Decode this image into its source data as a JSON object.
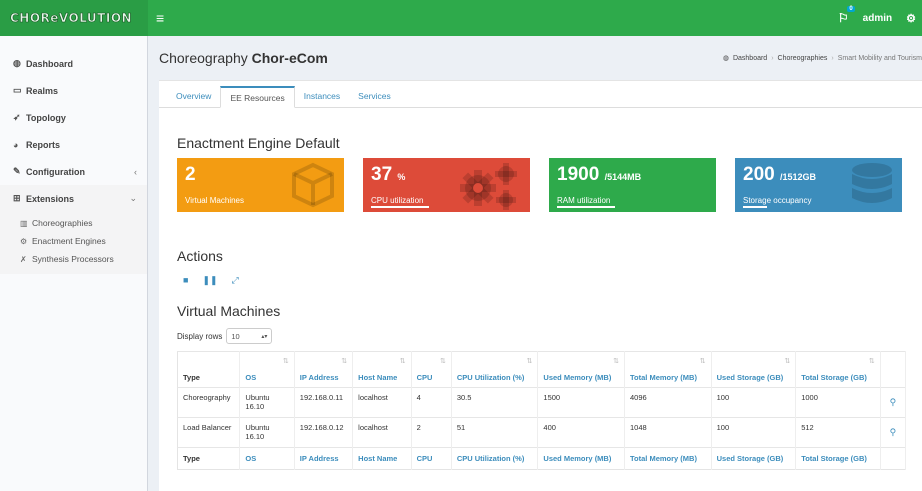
{
  "app": {
    "logo_text": "CHOReVOLUTION",
    "user": "admin",
    "notification_count": "0"
  },
  "sidebar": {
    "items": [
      {
        "label": "Dashboard",
        "icon": "dashboard-icon"
      },
      {
        "label": "Realms",
        "icon": "folder-icon"
      },
      {
        "label": "Topology",
        "icon": "rocket-icon"
      },
      {
        "label": "Reports",
        "icon": "pie-chart-icon"
      },
      {
        "label": "Configuration",
        "icon": "edit-icon"
      },
      {
        "label": "Extensions",
        "icon": "sitemap-icon"
      }
    ],
    "subitems": [
      {
        "label": "Choreographies",
        "icon": "bar-chart-icon"
      },
      {
        "label": "Enactment Engines",
        "icon": "gears-icon"
      },
      {
        "label": "Synthesis Processors",
        "icon": "wrench-icon"
      }
    ]
  },
  "header": {
    "title_prefix": "Choreography",
    "title_name": "Chor-eCom",
    "breadcrumb": [
      "Dashboard",
      "Choreographies",
      "Smart Mobility and Tourism"
    ]
  },
  "tabs": [
    {
      "label": "Overview"
    },
    {
      "label": "EE Resources",
      "active": true
    },
    {
      "label": "Instances"
    },
    {
      "label": "Services"
    }
  ],
  "ee_title": "Enactment Engine Default",
  "stats": [
    {
      "value": "2",
      "unit": "",
      "label": "Virtual Machines",
      "color": "#f39c12"
    },
    {
      "value": "37",
      "unit": "%",
      "label": "CPU utilization",
      "color": "#dd4b39"
    },
    {
      "value": "1900",
      "unit": "/5144MB",
      "label": "RAM utilization",
      "color": "#2eaa4b"
    },
    {
      "value": "200",
      "unit": "/1512GB",
      "label": "Storage occupancy",
      "color": "#3c8dbc"
    }
  ],
  "actions_title": "Actions",
  "vm_title": "Virtual Machines",
  "display_rows": {
    "label": "Display rows",
    "value": "10"
  },
  "table": {
    "headers": [
      "Type",
      "OS",
      "IP Address",
      "Host Name",
      "CPU",
      "CPU Utilization (%)",
      "Used Memory (MB)",
      "Total Memory (MB)",
      "Used Storage (GB)",
      "Total Storage (GB)"
    ],
    "rows": [
      [
        "Choreography",
        "Ubuntu 16.10",
        "192.168.0.11",
        "localhost",
        "4",
        "30.5",
        "1500",
        "4096",
        "100",
        "1000"
      ],
      [
        "Load Balancer",
        "Ubuntu 16.10",
        "192.168.0.12",
        "localhost",
        "2",
        "51",
        "400",
        "1048",
        "100",
        "512"
      ]
    ]
  }
}
